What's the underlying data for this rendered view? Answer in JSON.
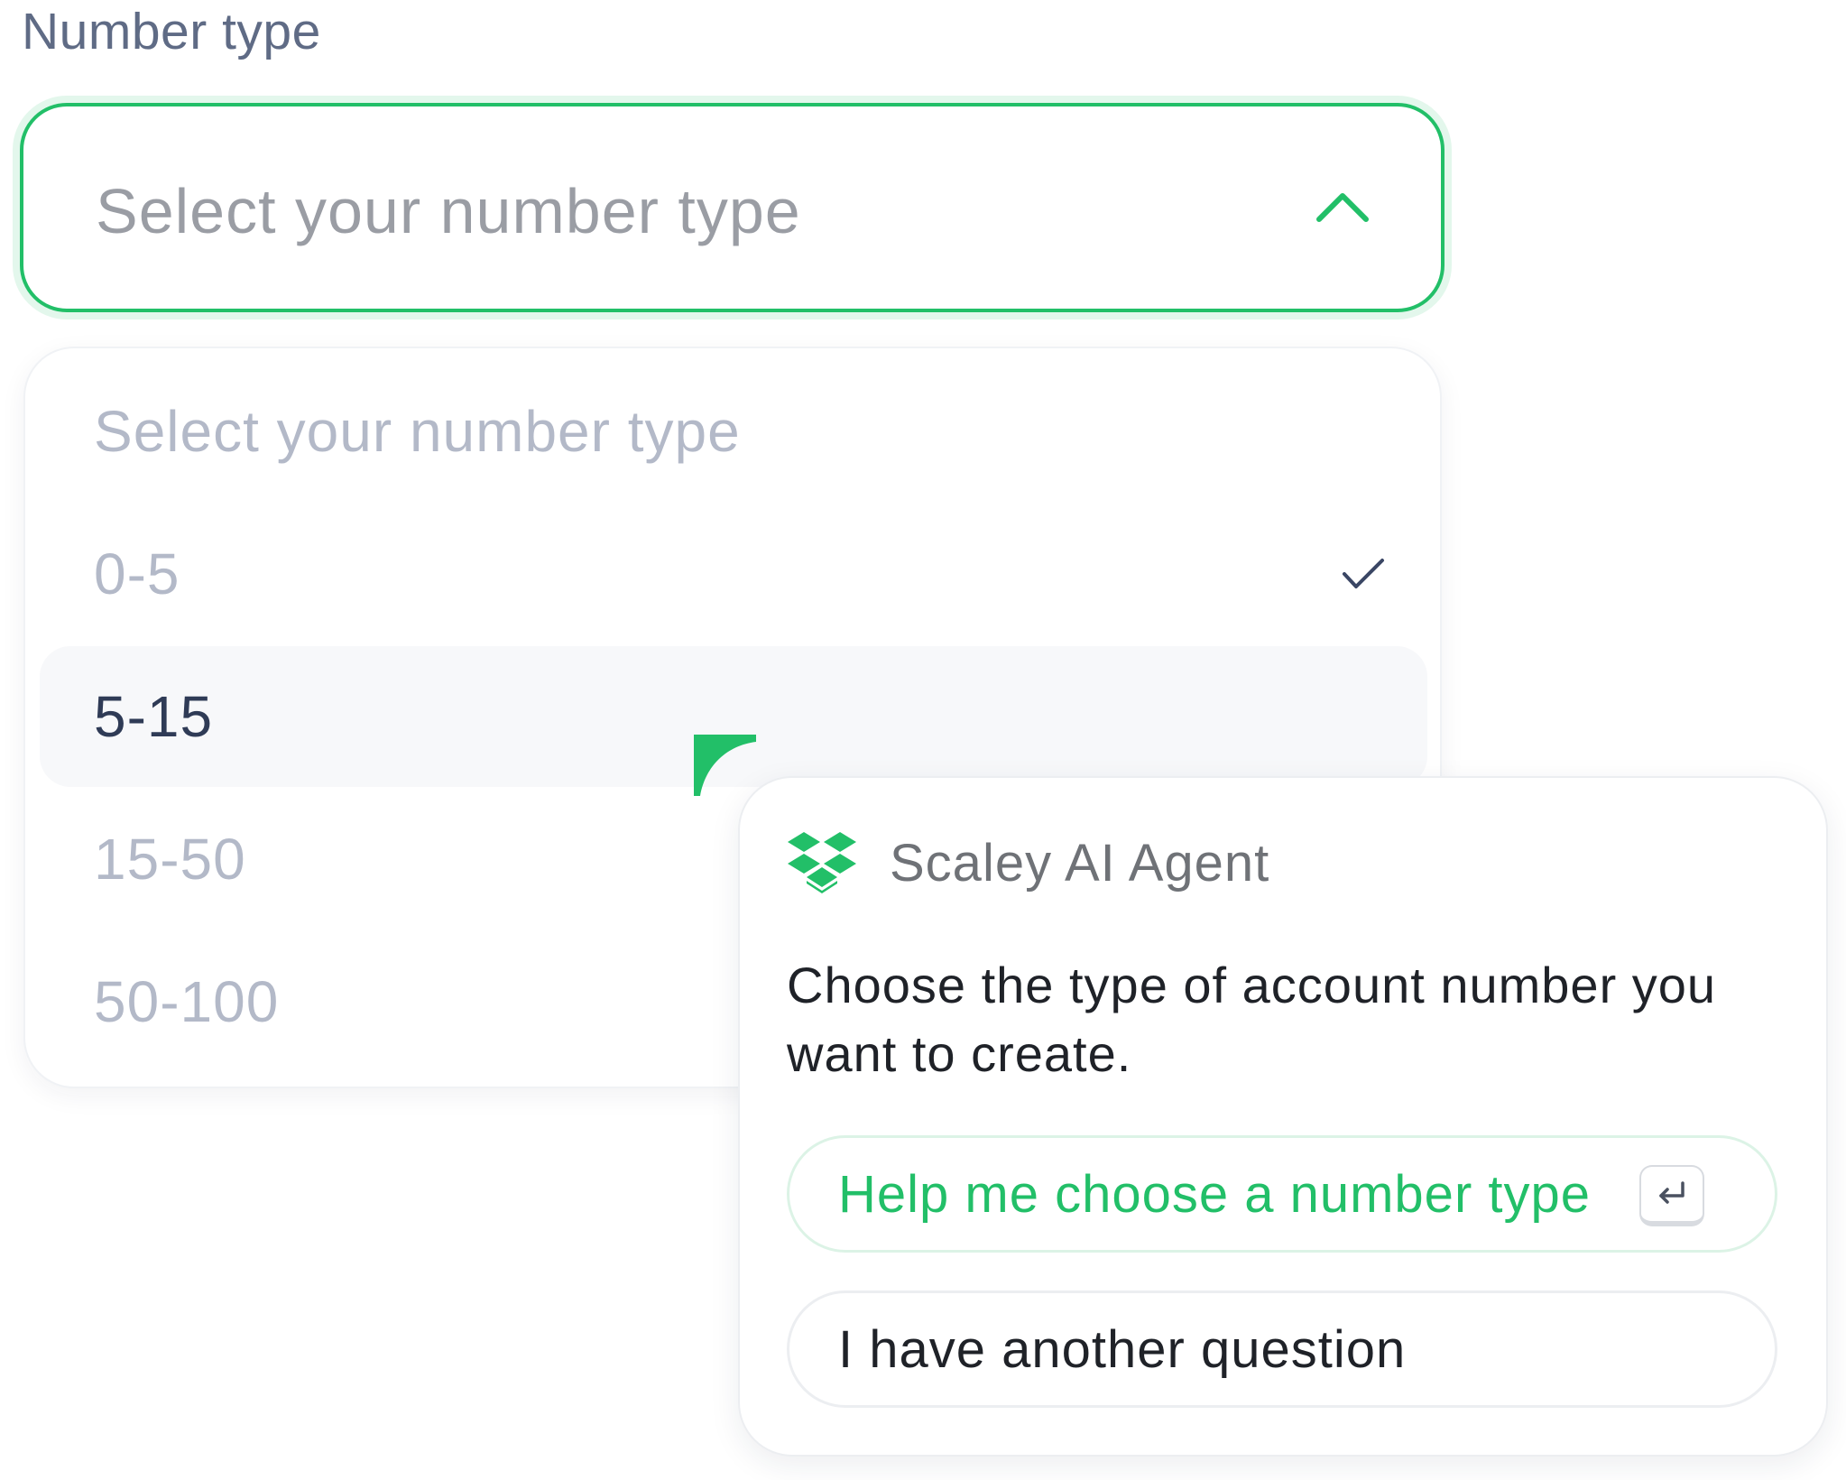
{
  "field": {
    "label": "Number type",
    "placeholder": "Select your number type"
  },
  "dropdown": {
    "placeholder_option": "Select your number type",
    "options": [
      "0-5",
      "5-15",
      "15-50",
      "50-100"
    ],
    "selected_option": "0-5",
    "hovered_option": "5-15"
  },
  "agent": {
    "name": "Scaley AI Agent",
    "message": "Choose the type of account number you want to create.",
    "primary_action": "Help me choose a number type",
    "secondary_action": "I have another question",
    "logo_icon": "dropbox-logo-icon",
    "shortcut_icon": "enter-key-icon"
  },
  "colors": {
    "accent": "#22bf68",
    "text_dark": "#1f2228",
    "muted": "#b3b9c8"
  }
}
